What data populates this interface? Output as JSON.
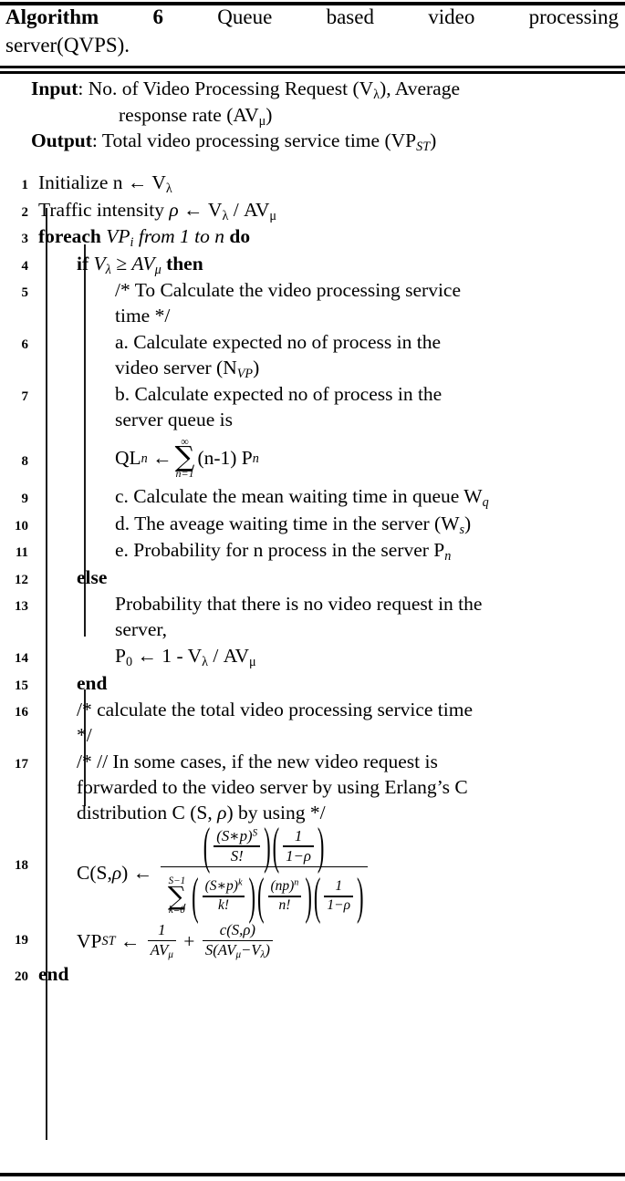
{
  "title": {
    "label": "Algorithm",
    "number": "6",
    "caption_line1": "Queue based video processing",
    "caption_line2": "server(QVPS)."
  },
  "io": {
    "input_label": "Input",
    "input_text_line1": "No. of Video Processing Request (Vλ), Average",
    "input_text_line2": "response rate (AVμ)",
    "output_label": "Output",
    "output_text": "Total video processing service time (VPST)"
  },
  "lines": [
    {
      "num": "1",
      "indent": 0,
      "text": "Initialize n ← Vλ"
    },
    {
      "num": "2",
      "indent": 0,
      "text": "Traffic intensity ρ ← Vλ / AVμ"
    },
    {
      "num": "3",
      "indent": 0,
      "text": "foreach VPi from 1 to n do"
    },
    {
      "num": "4",
      "indent": 1,
      "text": "if Vλ ≥ AVμ then"
    },
    {
      "num": "5",
      "indent": 2,
      "text": "/* To Calculate the video processing service time */"
    },
    {
      "num": "6",
      "indent": 2,
      "text": "a. Calculate expected no of process in the video server (NVP)"
    },
    {
      "num": "7",
      "indent": 2,
      "text": "b. Calculate expected no of process in the server queue is"
    },
    {
      "num": "8",
      "indent": 2,
      "text": "QLn ← ∑ n=1 ∞ (n-1) Pn"
    },
    {
      "num": "9",
      "indent": 2,
      "text": "c. Calculate the mean waiting time in queue Wq"
    },
    {
      "num": "10",
      "indent": 2,
      "text": "d. The aveage waiting time in the server (Ws)"
    },
    {
      "num": "11",
      "indent": 2,
      "text": "e. Probability for n process in the server Pn"
    },
    {
      "num": "12",
      "indent": 1,
      "text": "else"
    },
    {
      "num": "13",
      "indent": 2,
      "text": "Probability that there is no video request in the server,"
    },
    {
      "num": "14",
      "indent": 2,
      "text": "P0 ← 1 - Vλ / AVμ"
    },
    {
      "num": "15",
      "indent": 1,
      "text": "end"
    },
    {
      "num": "16",
      "indent": 1,
      "text": "/* calculate the total video processing service time */"
    },
    {
      "num": "17",
      "indent": 1,
      "text": "/* // In some cases, if the new video request is forwarded to the video server by using Erlang’s C distribution C (S, ρ) by using */"
    },
    {
      "num": "18",
      "indent": 1,
      "text": "C(S,ρ) ← ( (S*p)S / S! )( 1 / 1−ρ ) / ∑ k=0 S−1 ( (S*p)k / k! )( (np)n / n! )( 1 / 1−ρ )"
    },
    {
      "num": "19",
      "indent": 1,
      "text": "VPST ← 1 / AVμ + c(S,ρ) / S(AVμ−Vλ)"
    },
    {
      "num": "20",
      "indent": 0,
      "text": "end"
    }
  ],
  "line_fragments": {
    "l1": {
      "a": "Initialize n",
      "arrow": "←",
      "v": "V",
      "vsub": "λ"
    },
    "l2": {
      "a": "Traffic intensity",
      "rho": "ρ",
      "arrow": "←",
      "v": "V",
      "vsub": "λ",
      "slash": "/",
      "av": "AV",
      "avsub": "μ"
    },
    "l3": {
      "kw1": "foreach",
      "it": "VP",
      "itsub": "i",
      "it2": "from 1 to n",
      "kw2": "do"
    },
    "l4": {
      "kw1": "if",
      "v": "V",
      "vsub": "λ",
      "ge": "≥",
      "av": "AV",
      "avsub": "μ",
      "kw2": "then"
    },
    "l5": {
      "text": "/* To Calculate the video processing service",
      "text2": "time */"
    },
    "l6": {
      "text": "a. Calculate expected no of process in the",
      "text2": "video server (N",
      "sub": "VP",
      "text3": ")"
    },
    "l7": {
      "text": "b. Calculate expected no of process in the",
      "text2": "server queue is"
    },
    "l8": {
      "ql": "QL",
      "qlsub": "n",
      "arrow": "←",
      "sumtop": "∞",
      "sumsym": "∑",
      "sumbot": "n=1",
      "rest": "(n-1) P",
      "restsub": "n"
    },
    "l9": {
      "text": "c. Calculate the mean waiting time in queue W",
      "sub": "q"
    },
    "l10": {
      "text": "d. The aveage waiting time in the server (W",
      "sub": "s",
      "text2": ")"
    },
    "l11": {
      "text": "e. Probability for n process in the server P",
      "sub": "n"
    },
    "l12": {
      "kw": "else"
    },
    "l13": {
      "text": "Probability that there is no video request in the",
      "text2": "server,"
    },
    "l14": {
      "p": "P",
      "psub": "0",
      "arrow": "←",
      "one": "1 -",
      "v": "V",
      "vsub": "λ",
      "slash": "/",
      "av": "AV",
      "avsub": "μ"
    },
    "l15": {
      "kw": "end"
    },
    "l16": {
      "text": "/* calculate the total video processing service time",
      "text2": "*/"
    },
    "l17": {
      "text": "/* // In some cases, if the new video request is",
      "text2": "forwarded to the video server by using Erlang’s C",
      "text3": "distribution C (S,",
      "rho": "ρ",
      "text4": ") by using */"
    },
    "l18": {
      "lhs": "C(S,",
      "lhs_rho": "ρ",
      "lhs2": ")",
      "arrow": "←",
      "num_a_top": "(S*p)",
      "num_a_top_sup": "S",
      "num_a_bot": "S!",
      "num_b_top": "1",
      "num_b_bot": "1−ρ",
      "den_sum_top": "S−1",
      "den_sum_sym": "∑",
      "den_sum_bot": "k=0",
      "den_a_top": "(S*p)",
      "den_a_top_sup": "k",
      "den_a_bot": "k!",
      "den_b_top": "(np)",
      "den_b_top_sup": "n",
      "den_b_bot": "n!",
      "den_c_top": "1",
      "den_c_bot": "1−ρ"
    },
    "l19": {
      "lhs": "VP",
      "lhs_sub": "ST",
      "arrow": "←",
      "f1_top": "1",
      "f1_bot": "AV",
      "f1_bot_sub": "μ",
      "plus": "+",
      "f2_top": "c(S,ρ)",
      "f2_bot_a": "S(AV",
      "f2_bot_sub": "μ",
      "f2_bot_b": "−V",
      "f2_bot_sub2": "λ",
      "f2_bot_c": ")"
    },
    "l20": {
      "kw": "end"
    }
  }
}
